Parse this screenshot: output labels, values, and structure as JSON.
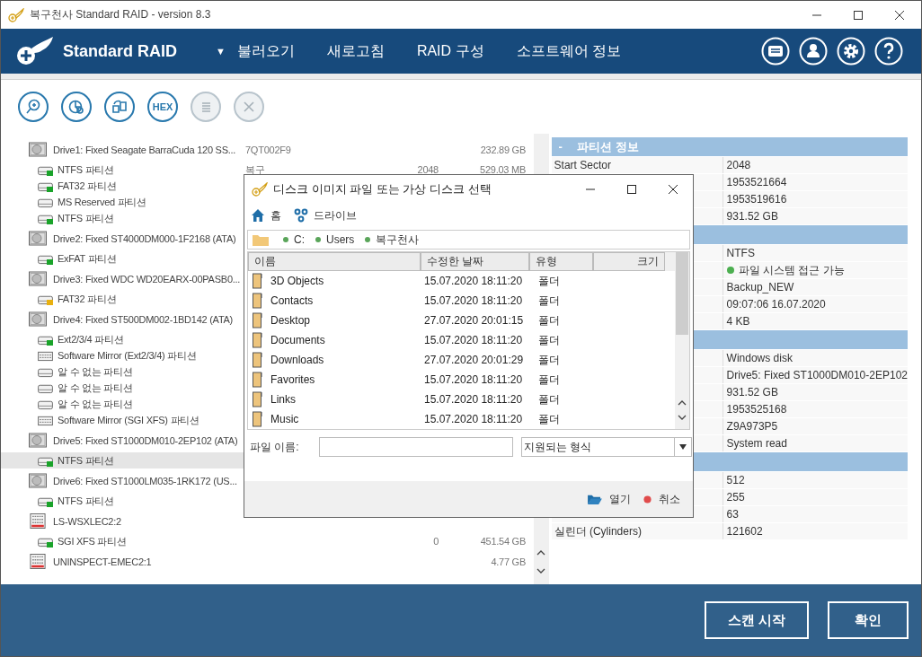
{
  "window": {
    "title": "복구천사 Standard RAID - version 8.3"
  },
  "header": {
    "logo": "Standard RAID",
    "menu_caret": "▼",
    "menu": [
      "불러오기",
      "새로고침",
      "RAID 구성",
      "소프트웨어 정보"
    ],
    "icons": [
      {
        "kind": "window"
      },
      {
        "kind": "user"
      },
      {
        "kind": "settings"
      },
      {
        "kind": "help"
      }
    ]
  },
  "toolbar": [
    {
      "kind": "search",
      "disabled": false
    },
    {
      "kind": "pie",
      "disabled": false
    },
    {
      "kind": "copy",
      "disabled": false
    },
    {
      "kind": "hex",
      "label": "HEX",
      "disabled": false
    },
    {
      "kind": "list",
      "disabled": true
    },
    {
      "kind": "close",
      "disabled": true
    }
  ],
  "tree": [
    {
      "kind": "disk",
      "name": "Drive1: Fixed Seagate BarraCuda 120 SS...",
      "col_2": "7QT002F9",
      "size": "232.89 GB",
      "selected": false,
      "children": [
        {
          "kind": "partition",
          "name": "NTFS 파티션",
          "col_2": "복구",
          "col_3": "2048",
          "size": "529.03 MB",
          "color": "#1aa32a",
          "selected": false
        },
        {
          "kind": "partition",
          "name": "FAT32 파티션",
          "color": "#1aa32a",
          "selected": false
        },
        {
          "kind": "partition",
          "name": "MS Reserved 파티션",
          "selected": false
        },
        {
          "kind": "partition",
          "name": "NTFS 파티션",
          "color": "#1aa32a",
          "selected": false
        }
      ]
    },
    {
      "kind": "disk",
      "name": "Drive2: Fixed ST4000DM000-1F2168 (ATA)",
      "selected": false,
      "children": [
        {
          "kind": "partition",
          "name": "ExFAT 파티션",
          "color": "#1aa32a",
          "selected": false
        }
      ]
    },
    {
      "kind": "disk",
      "name": "Drive3: Fixed WDC WD20EARX-00PASB0...",
      "selected": false,
      "children": [
        {
          "kind": "partition",
          "name": "FAT32 파티션",
          "color": "#e8b010",
          "selected": false
        }
      ]
    },
    {
      "kind": "disk",
      "name": "Drive4: Fixed ST500DM002-1BD142 (ATA)",
      "selected": false,
      "children": [
        {
          "kind": "partition",
          "name": "Ext2/3/4 파티션",
          "color": "#1aa32a",
          "selected": false
        },
        {
          "kind": "mirror",
          "name": "Software Mirror (Ext2/3/4) 파티션",
          "selected": false
        },
        {
          "kind": "partition",
          "name": "알 수 없는 파티션",
          "selected": false
        },
        {
          "kind": "partition",
          "name": "알 수 없는 파티션",
          "selected": false
        },
        {
          "kind": "partition",
          "name": "알 수 없는 파티션",
          "selected": false
        },
        {
          "kind": "mirror",
          "name": "Software Mirror (SGI XFS) 파티션",
          "selected": false
        }
      ]
    },
    {
      "kind": "disk",
      "name": "Drive5: Fixed ST1000DM010-2EP102 (ATA)",
      "selected": false,
      "children": [
        {
          "kind": "partition",
          "name": "NTFS 파티션",
          "color": "#1aa32a",
          "selected": true
        }
      ]
    },
    {
      "kind": "disk",
      "name": "Drive6: Fixed ST1000LM035-1RK172 (US...",
      "selected": false,
      "children": [
        {
          "kind": "partition",
          "name": "NTFS 파티션",
          "color": "#1aa32a",
          "selected": false
        }
      ]
    },
    {
      "kind": "raid",
      "name": "LS-WSXLEC2:2",
      "selected": false,
      "children": [
        {
          "kind": "partition",
          "name": "SGI XFS 파티션",
          "col_3": "0",
          "size": "451.54 GB",
          "color": "#1aa32a",
          "selected": false
        }
      ]
    },
    {
      "kind": "raid",
      "name": "UNINSPECT-EMEC2:1",
      "size": "4.77 GB",
      "selected": false
    }
  ],
  "info": [
    {
      "toggle": "-",
      "title": "파티션 정보",
      "rows": [
        {
          "label": "Start Sector",
          "value": "2048"
        },
        {
          "value": "1953521664"
        },
        {
          "value": "1953519616"
        },
        {
          "value": "931.52 GB"
        }
      ]
    },
    {
      "rows": [
        {
          "value": "NTFS"
        },
        {
          "value": "파일 시스템 접근 가능",
          "color": "#4caf50"
        },
        {
          "value": "Backup_NEW"
        },
        {
          "value": "09:07:06 16.07.2020"
        },
        {
          "value": "4 KB"
        }
      ]
    },
    {
      "rows": [
        {
          "value": "Windows disk"
        },
        {
          "value": "Drive5: Fixed ST1000DM010-2EP102"
        },
        {
          "value": "931.52 GB"
        },
        {
          "value": "1953525168"
        },
        {
          "value": "Z9A973P5"
        },
        {
          "value": "System read"
        }
      ]
    },
    {
      "rows": [
        {
          "value": "512"
        },
        {
          "value": "255"
        },
        {
          "value": "63"
        },
        {
          "label": "실린더 (Cylinders)",
          "value": "121602"
        }
      ]
    }
  ],
  "dialog": {
    "title": "디스크 이미지 파일 또는 가상 디스크 선택",
    "nav": [
      {
        "kind": "home",
        "label": "홈"
      },
      {
        "kind": "drives",
        "label": "드라이브"
      }
    ],
    "path": [
      "C:",
      "Users",
      "복구천사"
    ],
    "columns": [
      "이름",
      "수정한 날짜",
      "유형",
      "크기"
    ],
    "rows": [
      {
        "name": "3D Objects",
        "modified": "15.07.2020 18:11:20",
        "type": "폴더",
        "selected": false
      },
      {
        "name": "Contacts",
        "modified": "15.07.2020 18:11:20",
        "type": "폴더",
        "selected": false
      },
      {
        "name": "Desktop",
        "modified": "27.07.2020 20:01:15",
        "type": "폴더",
        "selected": false
      },
      {
        "name": "Documents",
        "modified": "15.07.2020 18:11:20",
        "type": "폴더",
        "selected": false
      },
      {
        "name": "Downloads",
        "modified": "27.07.2020 20:01:29",
        "type": "폴더",
        "selected": false
      },
      {
        "name": "Favorites",
        "modified": "15.07.2020 18:11:20",
        "type": "폴더",
        "selected": false
      },
      {
        "name": "Links",
        "modified": "15.07.2020 18:11:20",
        "type": "폴더",
        "selected": false
      },
      {
        "name": "Music",
        "modified": "15.07.2020 18:11:20",
        "type": "폴더",
        "selected": false
      }
    ],
    "filename_label": "파일 이름:",
    "filter": "지원되는 형식",
    "buttons": [
      {
        "kind": "open",
        "label": "열기"
      },
      {
        "kind": "cancel",
        "label": "취소"
      }
    ]
  },
  "footer": {
    "buttons": [
      "스캔 시작",
      "확인"
    ]
  }
}
